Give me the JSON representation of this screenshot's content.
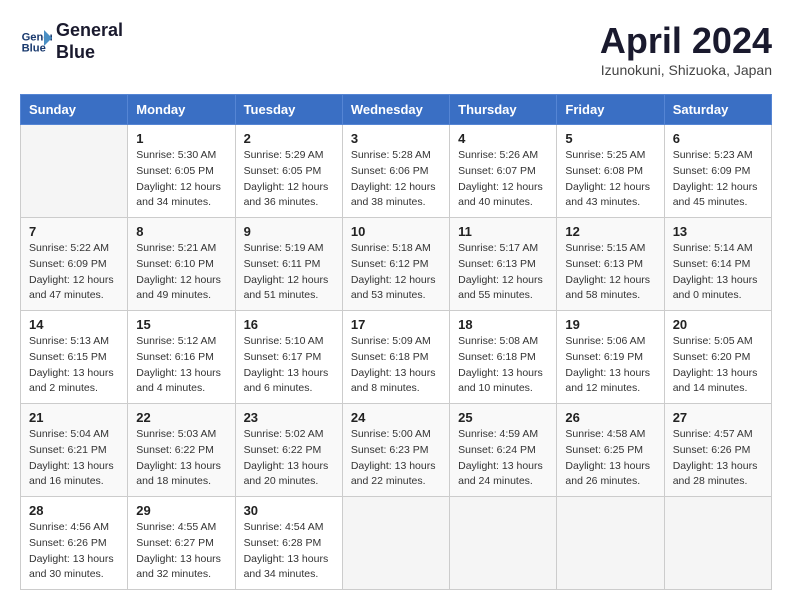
{
  "header": {
    "logo_line1": "General",
    "logo_line2": "Blue",
    "month_title": "April 2024",
    "location": "Izunokuni, Shizuoka, Japan"
  },
  "weekdays": [
    "Sunday",
    "Monday",
    "Tuesday",
    "Wednesday",
    "Thursday",
    "Friday",
    "Saturday"
  ],
  "weeks": [
    [
      {
        "day": "",
        "info": ""
      },
      {
        "day": "1",
        "info": "Sunrise: 5:30 AM\nSunset: 6:05 PM\nDaylight: 12 hours\nand 34 minutes."
      },
      {
        "day": "2",
        "info": "Sunrise: 5:29 AM\nSunset: 6:05 PM\nDaylight: 12 hours\nand 36 minutes."
      },
      {
        "day": "3",
        "info": "Sunrise: 5:28 AM\nSunset: 6:06 PM\nDaylight: 12 hours\nand 38 minutes."
      },
      {
        "day": "4",
        "info": "Sunrise: 5:26 AM\nSunset: 6:07 PM\nDaylight: 12 hours\nand 40 minutes."
      },
      {
        "day": "5",
        "info": "Sunrise: 5:25 AM\nSunset: 6:08 PM\nDaylight: 12 hours\nand 43 minutes."
      },
      {
        "day": "6",
        "info": "Sunrise: 5:23 AM\nSunset: 6:09 PM\nDaylight: 12 hours\nand 45 minutes."
      }
    ],
    [
      {
        "day": "7",
        "info": "Sunrise: 5:22 AM\nSunset: 6:09 PM\nDaylight: 12 hours\nand 47 minutes."
      },
      {
        "day": "8",
        "info": "Sunrise: 5:21 AM\nSunset: 6:10 PM\nDaylight: 12 hours\nand 49 minutes."
      },
      {
        "day": "9",
        "info": "Sunrise: 5:19 AM\nSunset: 6:11 PM\nDaylight: 12 hours\nand 51 minutes."
      },
      {
        "day": "10",
        "info": "Sunrise: 5:18 AM\nSunset: 6:12 PM\nDaylight: 12 hours\nand 53 minutes."
      },
      {
        "day": "11",
        "info": "Sunrise: 5:17 AM\nSunset: 6:13 PM\nDaylight: 12 hours\nand 55 minutes."
      },
      {
        "day": "12",
        "info": "Sunrise: 5:15 AM\nSunset: 6:13 PM\nDaylight: 12 hours\nand 58 minutes."
      },
      {
        "day": "13",
        "info": "Sunrise: 5:14 AM\nSunset: 6:14 PM\nDaylight: 13 hours\nand 0 minutes."
      }
    ],
    [
      {
        "day": "14",
        "info": "Sunrise: 5:13 AM\nSunset: 6:15 PM\nDaylight: 13 hours\nand 2 minutes."
      },
      {
        "day": "15",
        "info": "Sunrise: 5:12 AM\nSunset: 6:16 PM\nDaylight: 13 hours\nand 4 minutes."
      },
      {
        "day": "16",
        "info": "Sunrise: 5:10 AM\nSunset: 6:17 PM\nDaylight: 13 hours\nand 6 minutes."
      },
      {
        "day": "17",
        "info": "Sunrise: 5:09 AM\nSunset: 6:18 PM\nDaylight: 13 hours\nand 8 minutes."
      },
      {
        "day": "18",
        "info": "Sunrise: 5:08 AM\nSunset: 6:18 PM\nDaylight: 13 hours\nand 10 minutes."
      },
      {
        "day": "19",
        "info": "Sunrise: 5:06 AM\nSunset: 6:19 PM\nDaylight: 13 hours\nand 12 minutes."
      },
      {
        "day": "20",
        "info": "Sunrise: 5:05 AM\nSunset: 6:20 PM\nDaylight: 13 hours\nand 14 minutes."
      }
    ],
    [
      {
        "day": "21",
        "info": "Sunrise: 5:04 AM\nSunset: 6:21 PM\nDaylight: 13 hours\nand 16 minutes."
      },
      {
        "day": "22",
        "info": "Sunrise: 5:03 AM\nSunset: 6:22 PM\nDaylight: 13 hours\nand 18 minutes."
      },
      {
        "day": "23",
        "info": "Sunrise: 5:02 AM\nSunset: 6:22 PM\nDaylight: 13 hours\nand 20 minutes."
      },
      {
        "day": "24",
        "info": "Sunrise: 5:00 AM\nSunset: 6:23 PM\nDaylight: 13 hours\nand 22 minutes."
      },
      {
        "day": "25",
        "info": "Sunrise: 4:59 AM\nSunset: 6:24 PM\nDaylight: 13 hours\nand 24 minutes."
      },
      {
        "day": "26",
        "info": "Sunrise: 4:58 AM\nSunset: 6:25 PM\nDaylight: 13 hours\nand 26 minutes."
      },
      {
        "day": "27",
        "info": "Sunrise: 4:57 AM\nSunset: 6:26 PM\nDaylight: 13 hours\nand 28 minutes."
      }
    ],
    [
      {
        "day": "28",
        "info": "Sunrise: 4:56 AM\nSunset: 6:26 PM\nDaylight: 13 hours\nand 30 minutes."
      },
      {
        "day": "29",
        "info": "Sunrise: 4:55 AM\nSunset: 6:27 PM\nDaylight: 13 hours\nand 32 minutes."
      },
      {
        "day": "30",
        "info": "Sunrise: 4:54 AM\nSunset: 6:28 PM\nDaylight: 13 hours\nand 34 minutes."
      },
      {
        "day": "",
        "info": ""
      },
      {
        "day": "",
        "info": ""
      },
      {
        "day": "",
        "info": ""
      },
      {
        "day": "",
        "info": ""
      }
    ]
  ]
}
